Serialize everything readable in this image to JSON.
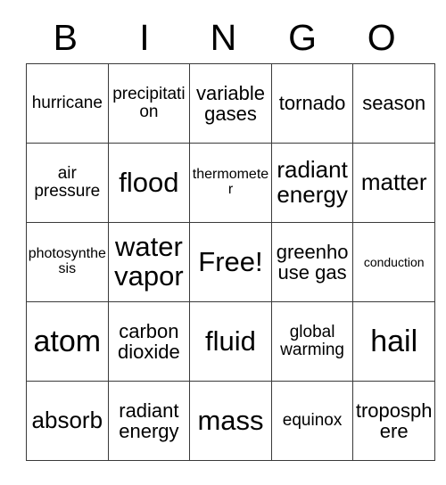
{
  "card": {
    "title_letters": [
      "B",
      "I",
      "N",
      "G",
      "O"
    ],
    "rows": [
      [
        {
          "text": "hurricane",
          "size": "fs-md"
        },
        {
          "text": "precipitation",
          "size": "fs-md"
        },
        {
          "text": "variable gases",
          "size": "fs-lg"
        },
        {
          "text": "tornado",
          "size": "fs-lg"
        },
        {
          "text": "season",
          "size": "fs-lg"
        }
      ],
      [
        {
          "text": "air pressure",
          "size": "fs-md"
        },
        {
          "text": "flood",
          "size": "fs-2xl"
        },
        {
          "text": "thermometer",
          "size": "fs-sm"
        },
        {
          "text": "radiant energy",
          "size": "fs-xl"
        },
        {
          "text": "matter",
          "size": "fs-xl"
        }
      ],
      [
        {
          "text": "photosynthesis",
          "size": "fs-sm"
        },
        {
          "text": "water vapor",
          "size": "fs-2xl"
        },
        {
          "text": "Free!",
          "size": "fs-2xl"
        },
        {
          "text": "greenhouse gas",
          "size": "fs-lg"
        },
        {
          "text": "conduction",
          "size": "fs-xs"
        }
      ],
      [
        {
          "text": "atom",
          "size": "fs-3xl"
        },
        {
          "text": "carbon dioxide",
          "size": "fs-lg"
        },
        {
          "text": "fluid",
          "size": "fs-2xl"
        },
        {
          "text": "global warming",
          "size": "fs-md"
        },
        {
          "text": "hail",
          "size": "fs-3xl"
        }
      ],
      [
        {
          "text": "absorb",
          "size": "fs-xl"
        },
        {
          "text": "radiant energy",
          "size": "fs-lg"
        },
        {
          "text": "mass",
          "size": "fs-2xl"
        },
        {
          "text": "equinox",
          "size": "fs-md"
        },
        {
          "text": "troposphere",
          "size": "fs-lg"
        }
      ]
    ]
  },
  "colors": {
    "background": "#ffffff",
    "text": "#000000",
    "border": "#3a3a3a"
  }
}
